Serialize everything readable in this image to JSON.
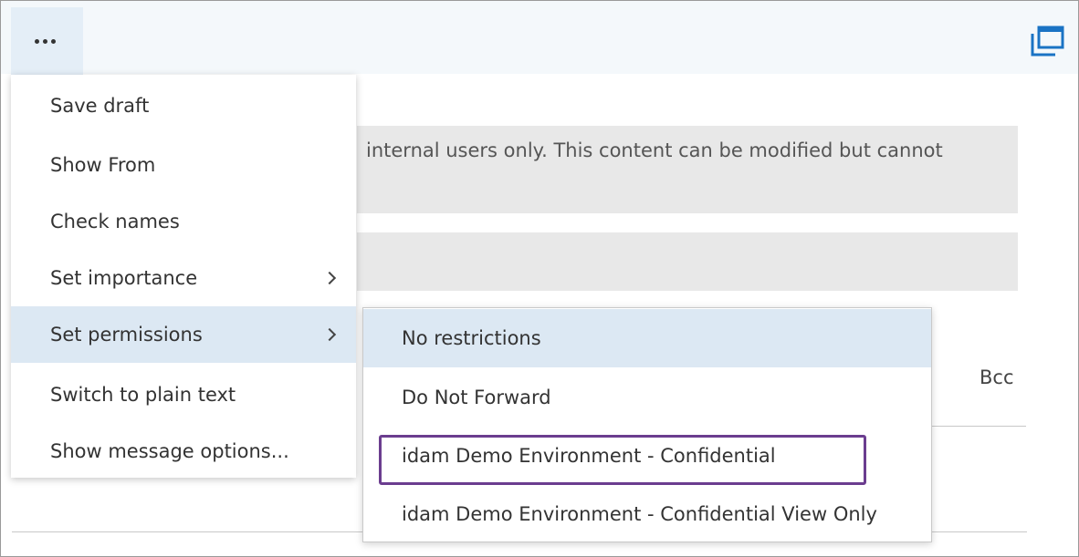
{
  "toolbar": {
    "more_icon": "ellipsis-icon",
    "popout_icon": "popout-window-icon"
  },
  "compose": {
    "info_text": "internal users only. This content can be modified but cannot",
    "bcc_label": "Bcc"
  },
  "menu": {
    "items": [
      {
        "label": "Save draft"
      },
      {
        "label": "Show From"
      },
      {
        "label": "Check names"
      },
      {
        "label": "Set importance",
        "has_submenu": true
      },
      {
        "label": "Set permissions",
        "has_submenu": true,
        "active": true
      },
      {
        "label": "Switch to plain text"
      },
      {
        "label": "Show message options..."
      }
    ]
  },
  "permissions_submenu": {
    "items": [
      {
        "label": "No restrictions",
        "active": true
      },
      {
        "label": "Do Not Forward"
      },
      {
        "label": "idam Demo Environment - Confidential",
        "highlighted": true
      },
      {
        "label": "idam Demo Environment - Confidential View Only"
      }
    ],
    "highlight_color": "#6b3d8f"
  },
  "colors": {
    "hover_bg": "#dce8f3",
    "toolbar_bg": "#f4f8fb",
    "band_bg": "#e8e8e8"
  }
}
